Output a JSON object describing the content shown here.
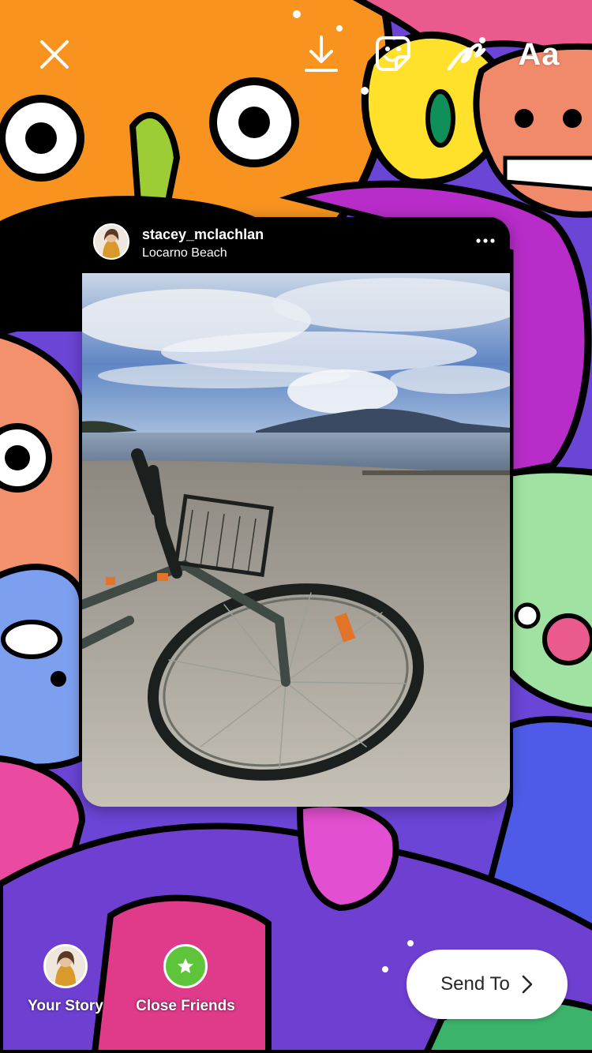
{
  "top_bar": {
    "text_tool_label": "Aa"
  },
  "post": {
    "username": "stacey_mclachlan",
    "location": "Locarno Beach"
  },
  "share": {
    "your_story_label": "Your Story",
    "close_friends_label": "Close Friends",
    "send_to_label": "Send To"
  },
  "colors": {
    "close_friends_green": "#5ec43a",
    "card_background": "#000000",
    "send_button_background": "#ffffff"
  }
}
